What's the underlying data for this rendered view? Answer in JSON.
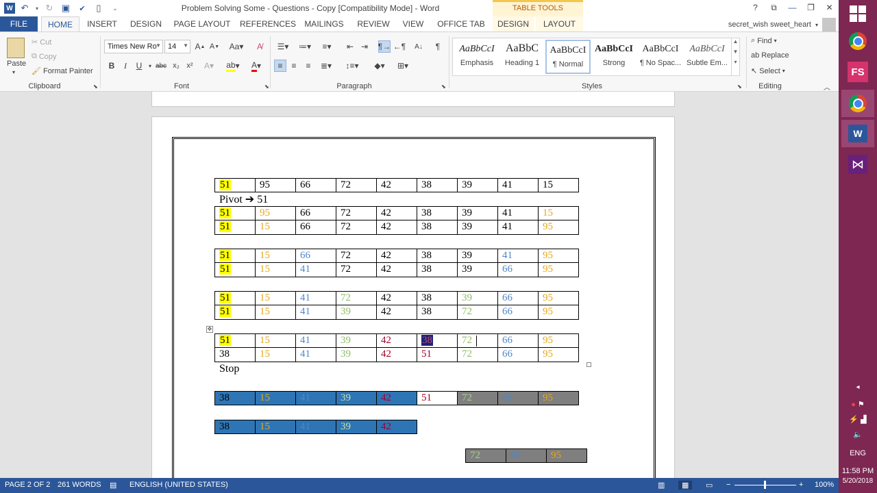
{
  "window": {
    "title": "Problem Solving Some - Questions - Copy [Compatibility Mode] - Word",
    "contextual_tab_group": "TABLE TOOLS",
    "user_name": "secret_wish sweet_heart"
  },
  "tabs": [
    "FILE",
    "HOME",
    "INSERT",
    "DESIGN",
    "PAGE LAYOUT",
    "REFERENCES",
    "MAILINGS",
    "REVIEW",
    "VIEW",
    "OFFICE TAB",
    "DESIGN",
    "LAYOUT"
  ],
  "ribbon": {
    "clipboard": {
      "paste": "Paste",
      "cut": "Cut",
      "copy": "Copy",
      "format_painter": "Format Painter",
      "label": "Clipboard"
    },
    "font": {
      "font_name": "Times New Ro",
      "font_size": "14",
      "label": "Font"
    },
    "paragraph": {
      "label": "Paragraph"
    },
    "styles": {
      "label": "Styles",
      "items": [
        {
          "preview": "AaBbCcI",
          "name": "Emphasis"
        },
        {
          "preview": "AaBbC",
          "name": "Heading 1"
        },
        {
          "preview": "AaBbCcI",
          "name": "¶ Normal"
        },
        {
          "preview": "AaBbCcI",
          "name": "Strong"
        },
        {
          "preview": "AaBbCcI",
          "name": "¶ No Spac..."
        },
        {
          "preview": "AaBbCcI",
          "name": "Subtle Em..."
        }
      ]
    },
    "editing": {
      "find": "Find",
      "replace": "Replace",
      "select": "Select",
      "label": "Editing"
    }
  },
  "document": {
    "pivot_note": "Pivot ➔ 51",
    "stop_note": "Stop",
    "rows": [
      [
        "51",
        "95",
        "66",
        "72",
        "42",
        "38",
        "39",
        "41",
        "15"
      ],
      [
        "51",
        "95",
        "66",
        "72",
        "42",
        "38",
        "39",
        "41",
        "15"
      ],
      [
        "51",
        "15",
        "66",
        "72",
        "42",
        "38",
        "39",
        "41",
        "95"
      ],
      [
        "51",
        "15",
        "66",
        "72",
        "42",
        "38",
        "39",
        "41",
        "95"
      ],
      [
        "51",
        "15",
        "41",
        "72",
        "42",
        "38",
        "39",
        "66",
        "95"
      ],
      [
        "51",
        "15",
        "41",
        "72",
        "42",
        "38",
        "39",
        "66",
        "95"
      ],
      [
        "51",
        "15",
        "41",
        "39",
        "42",
        "38",
        "72",
        "66",
        "95"
      ],
      [
        "51",
        "15",
        "41",
        "39",
        "42",
        "38",
        "72",
        "66",
        "95"
      ],
      [
        "38",
        "15",
        "41",
        "39",
        "42",
        "51",
        "72",
        "66",
        "95"
      ],
      [
        "38",
        "15",
        "41",
        "39",
        "42",
        "51",
        "72",
        "66",
        "95"
      ],
      [
        "38",
        "15",
        "41",
        "39",
        "42"
      ],
      [
        "72",
        "66",
        "95"
      ]
    ]
  },
  "status": {
    "page": "PAGE 2 OF 2",
    "words": "261 WORDS",
    "language": "ENGLISH (UNITED STATES)",
    "zoom": "100%"
  },
  "taskbar": {
    "time": "11:58 PM",
    "date": "5/20/2018",
    "lang": "ENG"
  },
  "colors": {
    "word_blue": "#2b579a",
    "highlight_yellow": "#ffff00",
    "gold": "#e6a817",
    "blue": "#4f86c6",
    "green": "#8fbc65",
    "red": "#a3002a",
    "fill_blue": "#2e75b6",
    "fill_gray": "#7f7f7f",
    "taskbar": "#7e2752"
  }
}
